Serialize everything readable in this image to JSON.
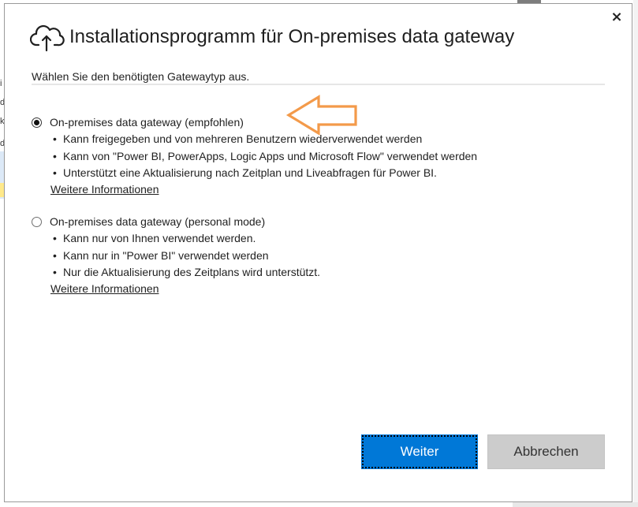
{
  "background": {
    "left_fragments": [
      "i",
      "d",
      "k",
      "d"
    ]
  },
  "dialog": {
    "title": "Installationsprogramm für On-premises data gateway",
    "title_icon": "cloud-upload-icon",
    "close_label": "×",
    "subtitle": "Wählen Sie den benötigten Gatewaytyp aus.",
    "options": [
      {
        "label": "On-premises data gateway (empfohlen)",
        "selected": true,
        "bullets": [
          "Kann freigegeben und von mehreren Benutzern wiederverwendet werden",
          "Kann von \"Power BI, PowerApps, Logic Apps und Microsoft Flow\" verwendet werden",
          "Unterstützt eine Aktualisierung nach Zeitplan und Liveabfragen für Power BI."
        ],
        "link": "Weitere Informationen"
      },
      {
        "label": "On-premises data gateway (personal mode)",
        "selected": false,
        "bullets": [
          "Kann nur von Ihnen verwendet werden.",
          "Kann nur in \"Power BI\" verwendet werden",
          "Nur die Aktualisierung des Zeitplans wird unterstützt."
        ],
        "link": "Weitere Informationen"
      }
    ],
    "bullet_char": "•",
    "buttons": {
      "next": "Weiter",
      "cancel": "Abbrechen"
    },
    "colors": {
      "accent": "#0078d7",
      "annotation_arrow": "#f39a4a",
      "cancel_bg": "#cccccc"
    }
  }
}
